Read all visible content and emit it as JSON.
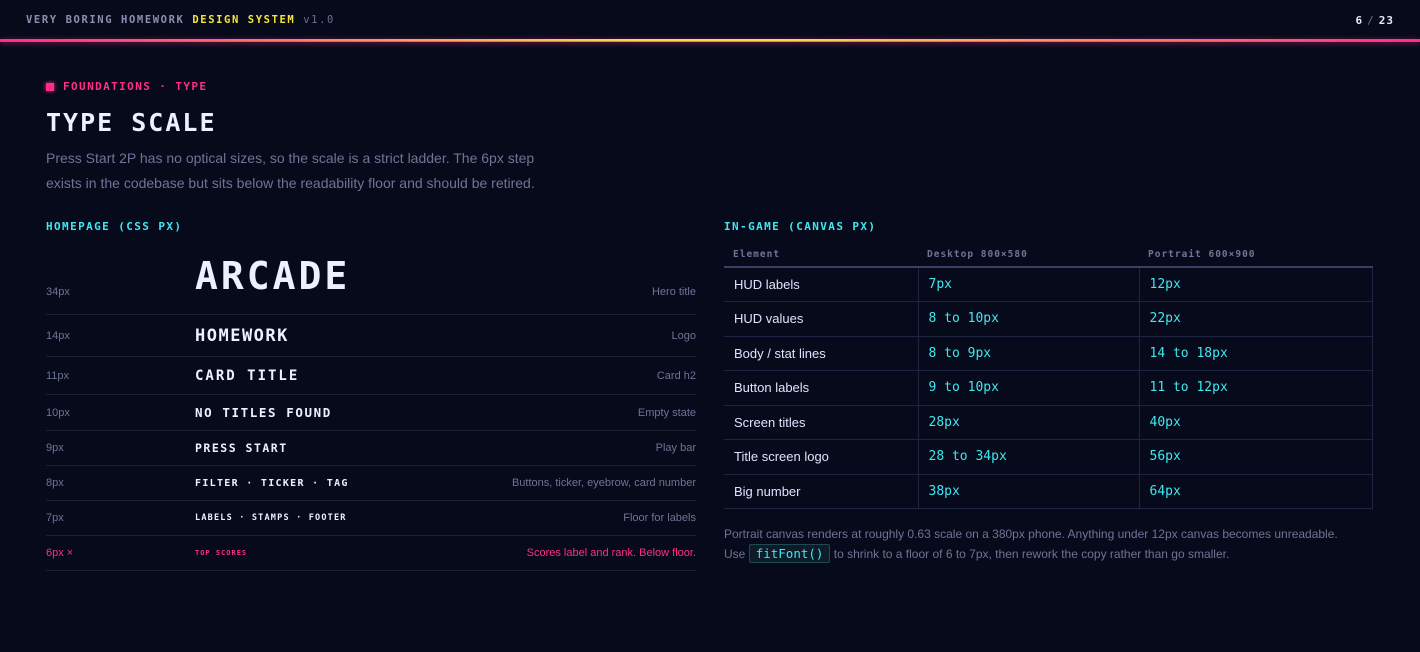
{
  "header": {
    "brand_main": "VERY BORING HOMEWORK",
    "brand_highlight": "DESIGN SYSTEM",
    "brand_version": "v1.0",
    "page_current": "6",
    "page_sep": "/",
    "page_total": "23"
  },
  "colors": {
    "background": "#070a1a",
    "accent_pink": "#ff2e88",
    "accent_yellow": "#f5e63c",
    "accent_cyan": "#3ee8f0"
  },
  "section": {
    "eyebrow": "FOUNDATIONS · TYPE",
    "title": "TYPE SCALE",
    "intro_line1": "Press Start 2P has no optical sizes, so the scale is a strict ladder. The 6px step",
    "intro_line2": "exists in the codebase but sits below the readability floor and should be retired."
  },
  "homepage": {
    "heading": "HOMEPAGE (CSS PX)",
    "rows": [
      {
        "size": "34px",
        "sample": "ARCADE",
        "use": "Hero title"
      },
      {
        "size": "14px",
        "sample": "HOMEWORK",
        "use": "Logo"
      },
      {
        "size": "11px",
        "sample": "CARD TITLE",
        "use": "Card h2"
      },
      {
        "size": "10px",
        "sample": "NO TITLES FOUND",
        "use": "Empty state"
      },
      {
        "size": "9px",
        "sample": "PRESS START",
        "use": "Play bar"
      },
      {
        "size": "8px",
        "sample": "FILTER · TICKER · TAG",
        "use": "Buttons, ticker, eyebrow, card number"
      },
      {
        "size": "7px",
        "sample": "LABELS · STAMPS · FOOTER",
        "use": "Floor for labels"
      },
      {
        "size": "6px ×",
        "sample": "TOP SCORES",
        "use": "Scores label and rank. Below floor."
      }
    ]
  },
  "ingame": {
    "heading": "IN-GAME (CANVAS PX)",
    "columns": [
      "Element",
      "Desktop 800×580",
      "Portrait 600×900"
    ],
    "rows": [
      [
        "HUD labels",
        "7px",
        "12px"
      ],
      [
        "HUD values",
        "8 to 10px",
        "22px"
      ],
      [
        "Body / stat lines",
        "8 to 9px",
        "14 to 18px"
      ],
      [
        "Button labels",
        "9 to 10px",
        "11 to 12px"
      ],
      [
        "Screen titles",
        "28px",
        "40px"
      ],
      [
        "Title screen logo",
        "28 to 34px",
        "56px"
      ],
      [
        "Big number",
        "38px",
        "64px"
      ]
    ],
    "note_part1": "Portrait canvas renders at roughly 0.63 scale on a 380px phone. Anything under 12px canvas becomes unreadable.",
    "note_use": "Use",
    "note_code": "fitFont()",
    "note_part2": "to shrink to a floor of 6 to 7px, then rework the copy rather than go smaller."
  }
}
